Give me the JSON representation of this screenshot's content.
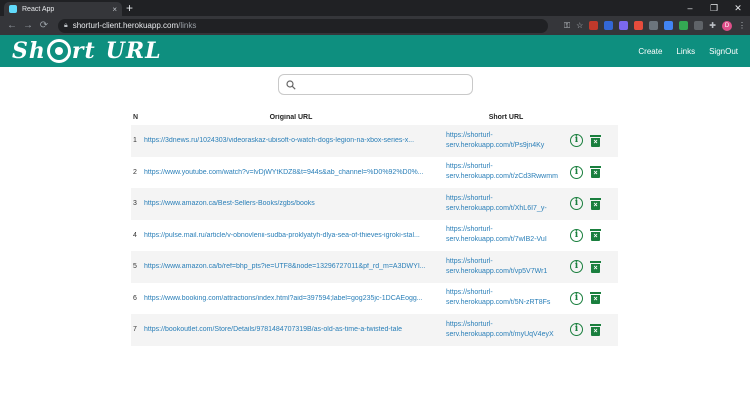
{
  "browser": {
    "tab_title": "React App",
    "tab_close": "×",
    "new_tab": "+",
    "url_host": "shorturl-client.herokuapp.com",
    "url_path": "/links",
    "back": "←",
    "forward": "→",
    "reload": "⟳",
    "win_min": "–",
    "win_max": "❐",
    "win_close": "✕",
    "key_icon": "⚿",
    "star_icon": "☆",
    "puzzle_icon": "✚",
    "avatar": "D",
    "menu": "⋮"
  },
  "app": {
    "logo_left": "Sh",
    "logo_mid": "rt",
    "logo_right": "URL",
    "nav": {
      "create": "Create",
      "links": "Links",
      "signout": "SignOut"
    }
  },
  "search": {
    "placeholder": ""
  },
  "table": {
    "headers": {
      "n": "N",
      "original": "Original URL",
      "short": "Short URL"
    },
    "rows": [
      {
        "n": "1",
        "original": "https://3dnews.ru/1024303/videoraskaz-ubisoft-o-watch-dogs-legion-na-xbox-series-x...",
        "short": "https://shorturl-serv.herokuapp.com/t/Ps9jn4Ky"
      },
      {
        "n": "2",
        "original": "https://www.youtube.com/watch?v=lvDjWYtKDZ8&t=944s&ab_channel=%D0%92%D0%...",
        "short": "https://shorturl-serv.herokuapp.com/t/zCd3Rwwmm"
      },
      {
        "n": "3",
        "original": "https://www.amazon.ca/Best-Sellers-Books/zgbs/books",
        "short": "https://shorturl-serv.herokuapp.com/t/XhL6I7_y-"
      },
      {
        "n": "4",
        "original": "https://pulse.mail.ru/article/v-obnovlenii-sudba-proklyatyh-dlya-sea-of-thieves-igroki-stal...",
        "short": "https://shorturl-serv.herokuapp.com/t/7wIB2-VuI"
      },
      {
        "n": "5",
        "original": "https://www.amazon.ca/b/ref=bhp_pts?ie=UTF8&node=13296727011&pf_rd_m=A3DWYI...",
        "short": "https://shorturl-serv.herokuapp.com/t/vp5V7Wr1"
      },
      {
        "n": "6",
        "original": "https://www.booking.com/attractions/index.html?aid=397594;label=gog235jc-1DCAEogg...",
        "short": "https://shorturl-serv.herokuapp.com/t/5N-zRT8Fs"
      },
      {
        "n": "7",
        "original": "https://bookoutlet.com/Store/Details/9781484707319B/as-old-as-time-a-twisted-tale",
        "short": "https://shorturl-serv.herokuapp.com/t/myUqV4eyX"
      }
    ]
  },
  "colors": {
    "brand": "#0e8f7f",
    "link": "#2a7fb8",
    "icon": "#1a7f3e"
  }
}
